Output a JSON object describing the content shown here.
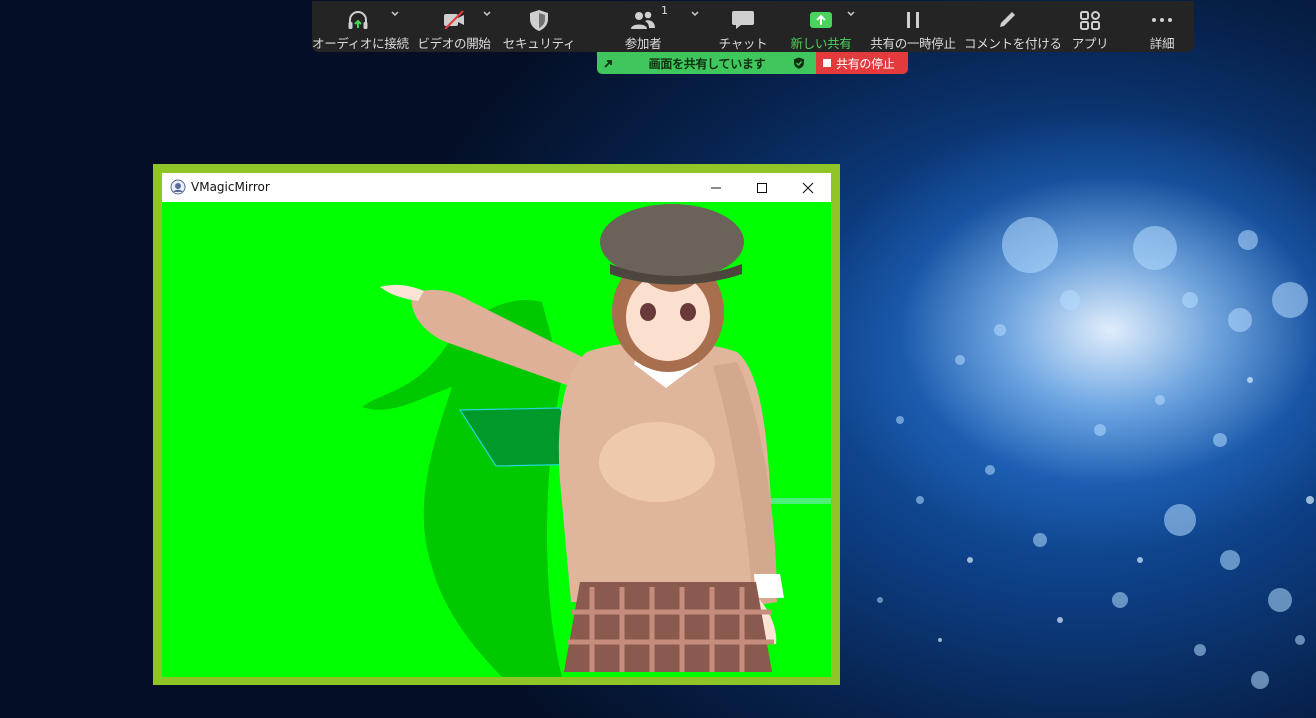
{
  "toolbar": {
    "audio": {
      "label": "オーディオに接続",
      "icon": "headphones-icon"
    },
    "video": {
      "label": "ビデオの開始",
      "icon": "video-off-icon"
    },
    "security": {
      "label": "セキュリティ",
      "icon": "shield-icon"
    },
    "participants": {
      "label": "参加者",
      "count": "1",
      "icon": "participants-icon"
    },
    "chat": {
      "label": "チャット",
      "icon": "chat-icon"
    },
    "new_share": {
      "label": "新しい共有",
      "icon": "share-up-arrow-icon"
    },
    "pause_share": {
      "label": "共有の一時停止",
      "icon": "pause-icon"
    },
    "annotate": {
      "label": "コメントを付ける",
      "icon": "pencil-icon"
    },
    "apps": {
      "label": "アプリ",
      "icon": "apps-icon"
    },
    "more": {
      "label": "詳細",
      "icon": "more-dots-icon"
    }
  },
  "share_banner": {
    "text": "画面を共有しています",
    "stop_label": "共有の停止"
  },
  "window": {
    "title": "VMagicMirror"
  },
  "colors": {
    "toolbar_bg": "#242424",
    "share_green": "#3fc65c",
    "stop_red": "#e33b3b",
    "frame_green": "#8fc526",
    "chroma_green": "#00ff00"
  }
}
